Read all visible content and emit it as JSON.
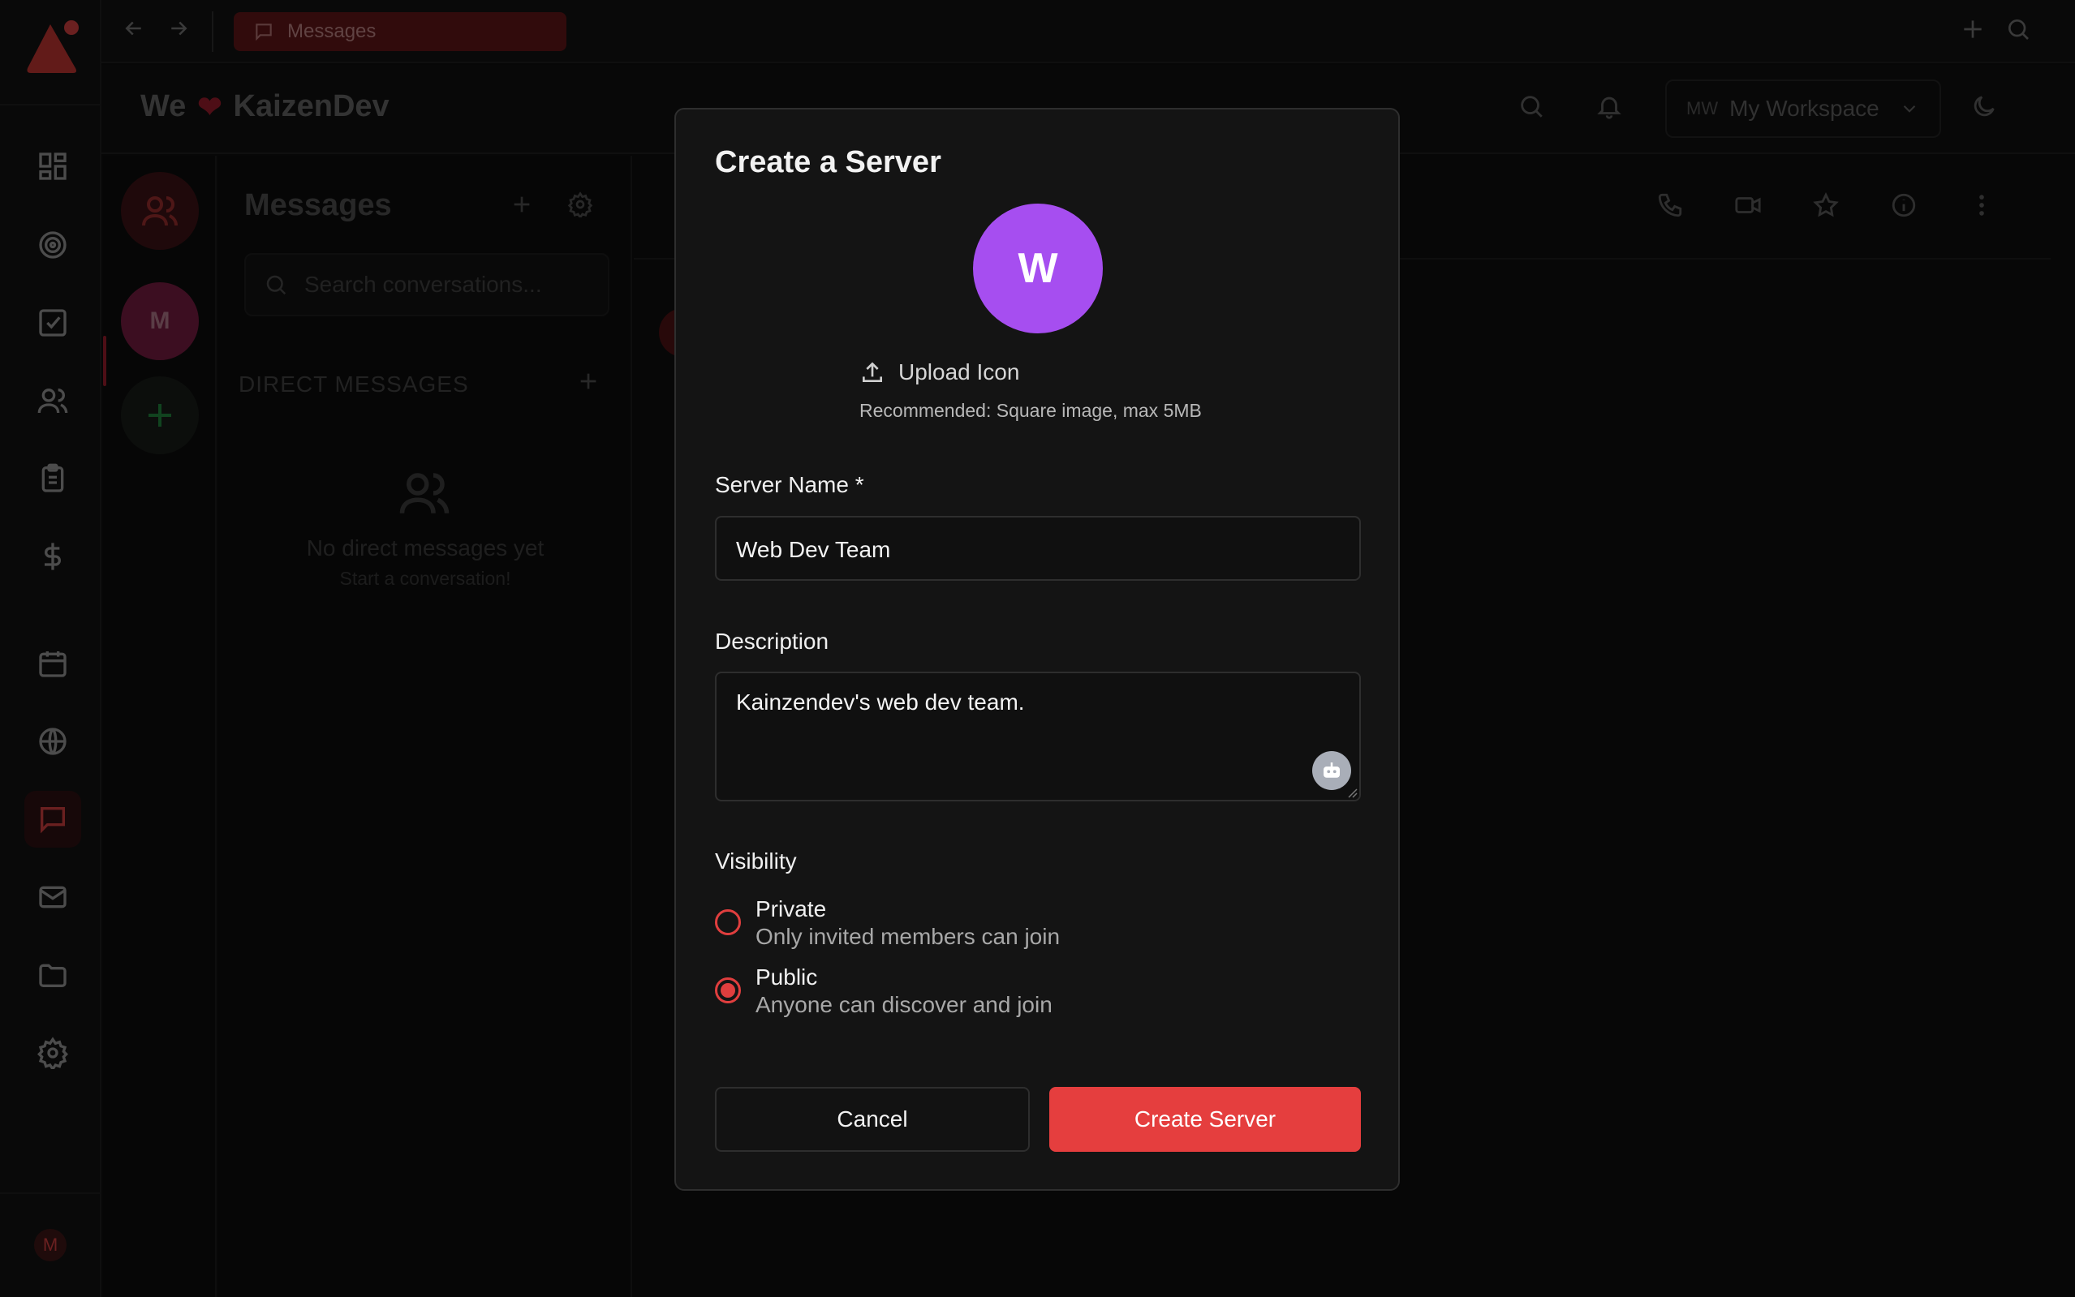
{
  "topbar": {
    "tab_label": "Messages"
  },
  "header": {
    "brand_we": "We",
    "brand_name": "KaizenDev",
    "workspace_initials": "MW",
    "workspace_name": "My Workspace"
  },
  "rail": {
    "user_initial": "M"
  },
  "servers": {
    "items": [
      {
        "initial": "M"
      }
    ]
  },
  "messages": {
    "title": "Messages",
    "search_placeholder": "Search conversations...",
    "dm_header": "DIRECT MESSAGES",
    "empty_title": "No direct messages yet",
    "empty_subtitle": "Start a conversation!"
  },
  "modal": {
    "title": "Create a Server",
    "avatar_letter": "W",
    "upload_label": "Upload Icon",
    "upload_hint": "Recommended: Square image, max 5MB",
    "server_name_label": "Server Name *",
    "server_name_value": "Web Dev Team",
    "description_label": "Description",
    "description_value": "Kainzendev's web dev team.",
    "visibility_label": "Visibility",
    "options": [
      {
        "title": "Private",
        "desc": "Only invited members can join",
        "selected": false
      },
      {
        "title": "Public",
        "desc": "Anyone can discover and join",
        "selected": true
      }
    ],
    "cancel_label": "Cancel",
    "create_label": "Create Server"
  },
  "colors": {
    "accent": "#e53e3e",
    "avatar": "#a64ef0"
  }
}
